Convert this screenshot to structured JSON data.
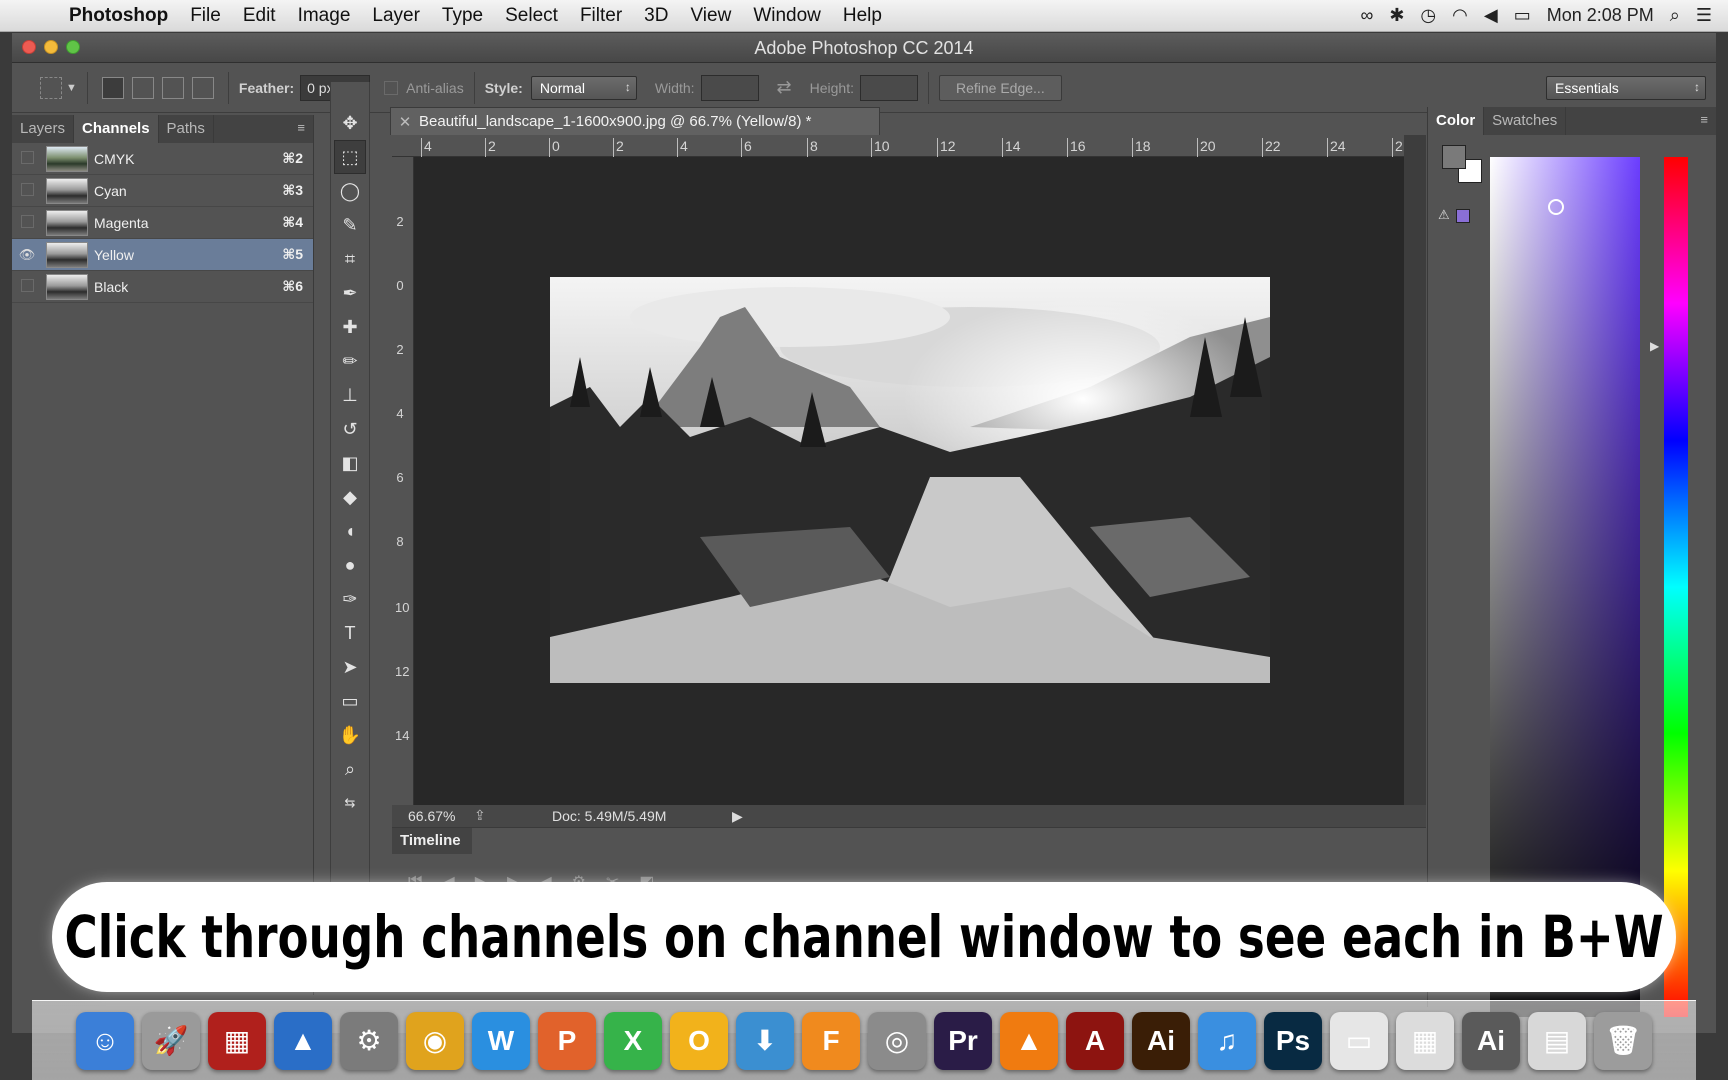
{
  "menubar": {
    "app": "Photoshop",
    "items": [
      "File",
      "Edit",
      "Image",
      "Layer",
      "Type",
      "Select",
      "Filter",
      "3D",
      "View",
      "Window",
      "Help"
    ],
    "clock": "Mon 2:08 PM"
  },
  "window": {
    "title": "Adobe Photoshop CC 2014"
  },
  "options": {
    "feather_label": "Feather:",
    "feather_value": "0 px",
    "antialias_label": "Anti-alias",
    "style_label": "Style:",
    "style_value": "Normal",
    "width_label": "Width:",
    "height_label": "Height:",
    "refine_edge": "Refine Edge...",
    "workspace": "Essentials"
  },
  "channels_panel": {
    "tabs": [
      "Layers",
      "Channels",
      "Paths"
    ],
    "active_tab": "Channels",
    "channels": [
      {
        "name": "CMYK",
        "shortcut": "⌘2",
        "visible": false,
        "selected": false
      },
      {
        "name": "Cyan",
        "shortcut": "⌘3",
        "visible": false,
        "selected": false
      },
      {
        "name": "Magenta",
        "shortcut": "⌘4",
        "visible": false,
        "selected": false
      },
      {
        "name": "Yellow",
        "shortcut": "⌘5",
        "visible": true,
        "selected": true
      },
      {
        "name": "Black",
        "shortcut": "⌘6",
        "visible": false,
        "selected": false
      }
    ]
  },
  "document": {
    "tab_title": "Beautiful_landscape_1-1600x900.jpg @ 66.7% (Yellow/8) *",
    "zoom": "66.67%",
    "doc_size": "Doc: 5.49M/5.49M",
    "ruler_top": [
      "4",
      "2",
      "0",
      "2",
      "4",
      "6",
      "8",
      "10",
      "12",
      "14",
      "16",
      "18",
      "20",
      "22",
      "24",
      "2"
    ],
    "ruler_left": [
      "2",
      "0",
      "2",
      "4",
      "6",
      "8",
      "10",
      "12",
      "14"
    ]
  },
  "timeline": {
    "title": "Timeline"
  },
  "color_panel": {
    "tabs": [
      "Color",
      "Swatches"
    ],
    "foreground": "#7a7a7a",
    "background": "#ffffff",
    "web_safe_swatch": "#8a6fd6",
    "picker_hue": "#6b3dff"
  },
  "caption": {
    "text": "Click through channels on channel window to see each in B+W"
  },
  "dock": {
    "apps": [
      {
        "name": "Finder",
        "glyph": "☺",
        "color": "#3b7fd8"
      },
      {
        "name": "Launchpad",
        "glyph": "🚀",
        "color": "#9a9a9a"
      },
      {
        "name": "Photo Booth",
        "glyph": "▦",
        "color": "#b0201c"
      },
      {
        "name": "Keynote",
        "glyph": "▲",
        "color": "#2a6ec7"
      },
      {
        "name": "System Preferences",
        "glyph": "⚙",
        "color": "#7b7b7b"
      },
      {
        "name": "Chrome",
        "glyph": "◉",
        "color": "#e0a31d"
      },
      {
        "name": "Word",
        "glyph": "W",
        "color": "#2a8fe0"
      },
      {
        "name": "PowerPoint",
        "glyph": "P",
        "color": "#e1622b"
      },
      {
        "name": "Excel",
        "glyph": "X",
        "color": "#36b34a"
      },
      {
        "name": "Outlook",
        "glyph": "O",
        "color": "#f2b21b"
      },
      {
        "name": "Downloads",
        "glyph": "⬇",
        "color": "#3b8fd1"
      },
      {
        "name": "Fusion 360",
        "glyph": "F",
        "color": "#f08a1e"
      },
      {
        "name": "Preview",
        "glyph": "◎",
        "color": "#8b8b8b"
      },
      {
        "name": "Premiere",
        "glyph": "Pr",
        "color": "#2a1c47"
      },
      {
        "name": "VLC",
        "glyph": "▲",
        "color": "#f07b10"
      },
      {
        "name": "Acrobat",
        "glyph": "A",
        "color": "#8d1410"
      },
      {
        "name": "Illustrator",
        "glyph": "Ai",
        "color": "#3a1e06"
      },
      {
        "name": "iTunes",
        "glyph": "♫",
        "color": "#3a8fe0"
      },
      {
        "name": "Photoshop",
        "glyph": "Ps",
        "color": "#082a42"
      },
      {
        "name": "Document",
        "glyph": "▭",
        "color": "#e6e6e6"
      },
      {
        "name": "Spreadsheet",
        "glyph": "▦",
        "color": "#dcdcdc"
      },
      {
        "name": "Illustrator File",
        "glyph": "Ai",
        "color": "#5a5a5a"
      },
      {
        "name": "Web Page",
        "glyph": "▤",
        "color": "#d8d8d8"
      },
      {
        "name": "Trash",
        "glyph": "🗑",
        "color": "#9c9c9c"
      }
    ]
  }
}
